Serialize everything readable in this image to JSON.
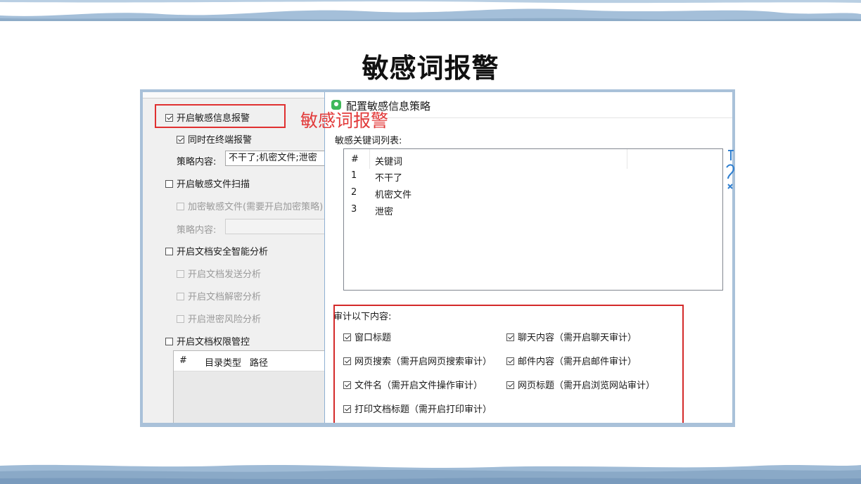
{
  "slide": {
    "title": "敏感词报警"
  },
  "annotation": {
    "label": "敏感词报警"
  },
  "left_panel": {
    "enable_alert": {
      "label": "开启敏感信息报警",
      "checked": true
    },
    "terminal_alert": {
      "label": "同时在终端报警",
      "checked": true
    },
    "policy1": {
      "label": "策略内容:",
      "value": "不干了;机密文件;泄密"
    },
    "file_scan": {
      "label": "开启敏感文件扫描",
      "checked": false
    },
    "encrypt_files": {
      "label": "加密敏感文件(需要开启加密策略)",
      "checked": false
    },
    "policy2": {
      "label": "策略内容:",
      "value": ""
    },
    "doc_analysis": {
      "label": "开启文档安全智能分析",
      "checked": false
    },
    "doc_send": {
      "label": "开启文档发送分析",
      "checked": false
    },
    "doc_decrypt": {
      "label": "开启文档解密分析",
      "checked": false
    },
    "leak_risk": {
      "label": "开启泄密风险分析",
      "checked": false
    },
    "doc_permission": {
      "label": "开启文档权限管控",
      "checked": false
    },
    "dir_table": {
      "columns": [
        "#",
        "目录类型",
        "路径"
      ]
    }
  },
  "dialog": {
    "title": "配置敏感信息策略",
    "keywords_label": "敏感关键词列表:",
    "keywords_table": {
      "columns": [
        "#",
        "关键词"
      ],
      "rows": [
        {
          "num": "1",
          "keyword": "不干了"
        },
        {
          "num": "2",
          "keyword": "机密文件"
        },
        {
          "num": "3",
          "keyword": "泄密"
        }
      ]
    },
    "audit_label": "审计以下内容:",
    "audit_options": {
      "window_title": "窗口标题",
      "web_search": "网页搜索（需开启网页搜索审计）",
      "file_name": "文件名（需开启文件操作审计）",
      "print_title": "打印文档标题（需开启打印审计）",
      "chat_content": "聊天内容（需开启聊天审计）",
      "mail_content": "邮件内容（需开启邮件审计）",
      "page_title": "网页标题（需开启浏览网站审计）"
    }
  },
  "colors": {
    "highlight": "#e03030",
    "frame": "#a9c1d9",
    "band": "#9db8d3"
  }
}
